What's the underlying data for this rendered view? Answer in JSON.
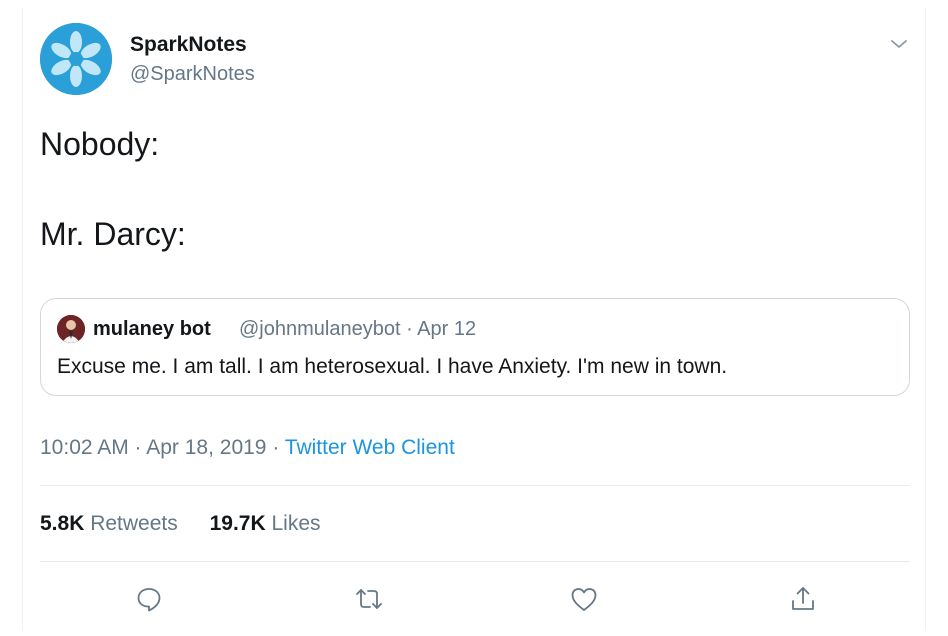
{
  "author": {
    "display_name": "SparkNotes",
    "handle": "@SparkNotes",
    "avatar_icon": "sparknotes-logo",
    "avatar_color": "#2a9fd8"
  },
  "tweet": {
    "lines": [
      "Nobody:",
      "",
      "Mr. Darcy:"
    ]
  },
  "quoted_tweet": {
    "display_name": "mulaney bot",
    "handle_date": "@johnmulaneybot · Apr 12",
    "text": "Excuse me. I am tall. I am heterosexual. I have Anxiety. I'm new in town."
  },
  "meta": {
    "timestamp": "10:02 AM · Apr 18, 2019 · ",
    "client": "Twitter Web Client"
  },
  "stats": {
    "retweets_count": "5.8K",
    "retweets_label": "Retweets",
    "likes_count": "19.7K",
    "likes_label": "Likes"
  },
  "icons": {
    "reply": "reply-icon",
    "retweet": "retweet-icon",
    "like": "heart-icon",
    "share": "share-icon",
    "caret": "chevron-down-icon"
  },
  "colors": {
    "link": "#1b95e0",
    "secondary_text": "#657786",
    "primary_text": "#14171a"
  }
}
